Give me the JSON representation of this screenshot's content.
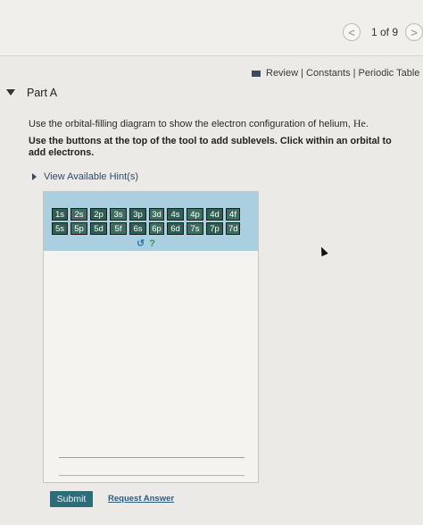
{
  "nav": {
    "prev_icon": "chevron-left-icon",
    "prev_glyph": "<",
    "next_icon": "chevron-right-icon",
    "next_glyph": ">",
    "pager": "1 of 9"
  },
  "links": {
    "icon": "book-icon",
    "text": "Review | Constants | Periodic Table"
  },
  "part": {
    "title": "Part A"
  },
  "instructions": {
    "line1_prefix": "Use the orbital-filling diagram to show the electron configuration of helium, ",
    "element": "He",
    "line1_suffix": ".",
    "line2": "Use the buttons at the top of the tool to add sublevels. Click within an orbital to add electrons."
  },
  "hints": {
    "label": "View Available Hint(s)"
  },
  "tool": {
    "row1": [
      "1s",
      "2s",
      "2p",
      "3s",
      "3p",
      "3d",
      "4s",
      "4p",
      "4d",
      "4f"
    ],
    "row2": [
      "5s",
      "5p",
      "5d",
      "5f",
      "6s",
      "6p",
      "6d",
      "7s",
      "7p",
      "7d"
    ],
    "reset_icon": "reset-icon",
    "reset_glyph": "↺",
    "help_icon": "help-icon",
    "help_glyph": "?"
  },
  "actions": {
    "submit": "Submit",
    "request": "Request Answer"
  }
}
